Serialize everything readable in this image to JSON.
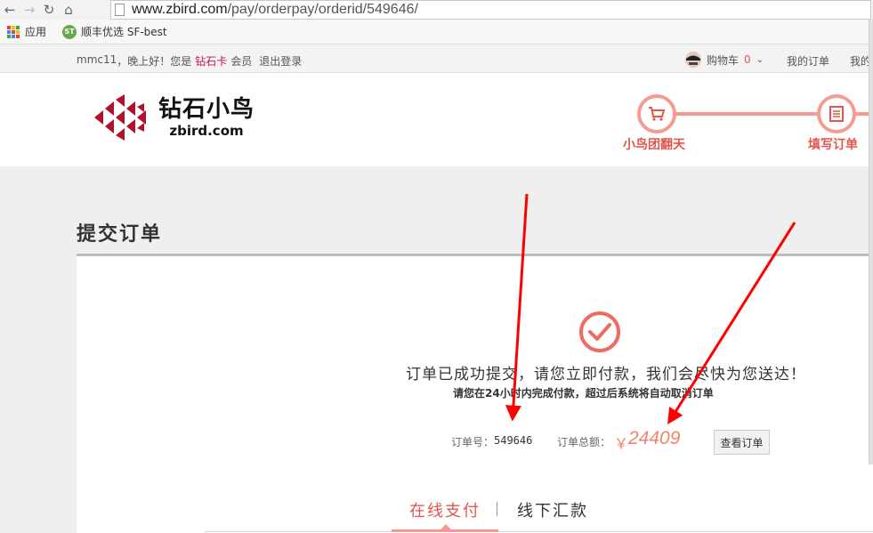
{
  "browser": {
    "url_host": "www.zbird.com",
    "url_path": "/pay/orderpay/orderid/549646/",
    "bookmarks": [
      {
        "label": "应用",
        "icon": "apps-grid-icon"
      },
      {
        "label": "顺丰优选 SF-best",
        "icon": "sf-logo-icon",
        "icon_text": "ST"
      }
    ]
  },
  "topbar": {
    "user": "mmc11",
    "greeting": "，晚上好！您是",
    "level": "钻石卡",
    "member": "会员",
    "logout": "退出登录",
    "cart_label": "购物车",
    "cart_count": "0",
    "my_orders": "我的订单",
    "my_more": "我的"
  },
  "header": {
    "logo_cn": "钻石小鸟",
    "logo_en": "zbird.com",
    "steps": [
      {
        "label": "小鸟团翻天",
        "icon": "cart-icon"
      },
      {
        "label": "填写订单",
        "icon": "form-icon"
      }
    ]
  },
  "main": {
    "page_title": "提交订单",
    "message": "订单已成功提交，请您立即付款，我们会尽快为您送达！",
    "sub_message": "请您在24小时内完成付款，超过后系统将自动取消订单",
    "order_no_label": "订单号：",
    "order_no": "549646",
    "total_label": "订单总额：",
    "currency": "￥",
    "total": "24409",
    "view_order": "查看订单",
    "tabs": [
      {
        "label": "在线支付",
        "active": true
      },
      {
        "label": "线下汇款",
        "active": false
      }
    ]
  },
  "colors": {
    "brand_red": "#c8104a",
    "accent": "#e4554c",
    "step_ring": "#f49c92",
    "annotation_arrow": "#ff0000"
  }
}
